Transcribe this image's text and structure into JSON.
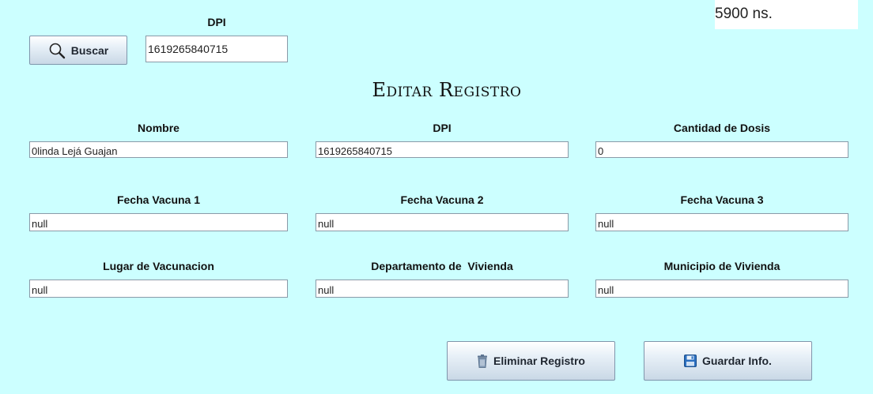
{
  "timer": {
    "text": "5900 ns."
  },
  "search": {
    "dpi_label": "DPI",
    "button_label": "Buscar",
    "button_icon": "search-icon",
    "dpi_value": "1619265840715"
  },
  "form": {
    "title": "Editar Registro",
    "fields": [
      {
        "label": "Nombre",
        "value": "0linda Lejá Guajan"
      },
      {
        "label": "DPI",
        "value": "1619265840715"
      },
      {
        "label": "Cantidad de Dosis",
        "value": "0"
      },
      {
        "label": "Fecha Vacuna 1",
        "value": "null"
      },
      {
        "label": "Fecha Vacuna 2",
        "value": "null"
      },
      {
        "label": "Fecha Vacuna 3",
        "value": "null"
      },
      {
        "label": "Lugar de Vacunacion",
        "value": "null"
      },
      {
        "label": "Departamento de  Vivienda",
        "value": "null"
      },
      {
        "label": "Municipio de Vivienda",
        "value": "null"
      }
    ]
  },
  "actions": {
    "delete_label": "Eliminar Registro",
    "delete_icon": "trash-icon",
    "save_label": "Guardar Info.",
    "save_icon": "floppy-disk-icon"
  },
  "colors": {
    "background": "#ccffff",
    "button_gradient_top": "#ffffff",
    "button_gradient_bottom": "#c9d8e6",
    "save_icon_color": "#2a6fc0"
  }
}
